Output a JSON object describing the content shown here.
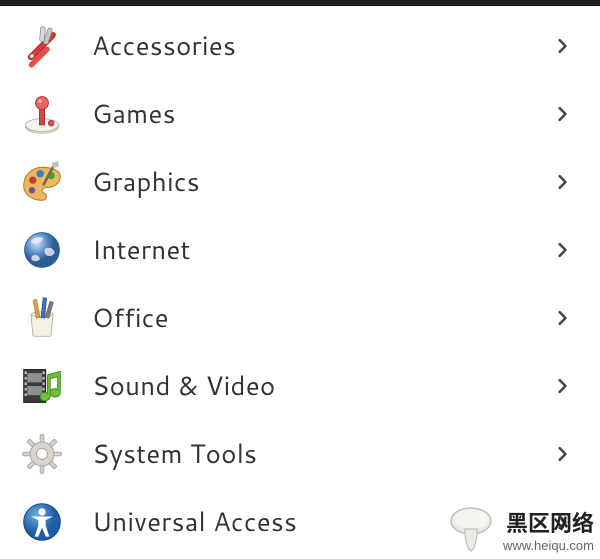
{
  "categories": [
    {
      "id": "accessories",
      "label": "Accessories",
      "icon": "swiss-army-knife-icon",
      "has_submenu": true
    },
    {
      "id": "games",
      "label": "Games",
      "icon": "joystick-icon",
      "has_submenu": true
    },
    {
      "id": "graphics",
      "label": "Graphics",
      "icon": "palette-icon",
      "has_submenu": true
    },
    {
      "id": "internet",
      "label": "Internet",
      "icon": "globe-icon",
      "has_submenu": true
    },
    {
      "id": "office",
      "label": "Office",
      "icon": "pen-holder-icon",
      "has_submenu": true
    },
    {
      "id": "sound-video",
      "label": "Sound & Video",
      "icon": "film-note-icon",
      "has_submenu": true
    },
    {
      "id": "system-tools",
      "label": "System Tools",
      "icon": "gear-icon",
      "has_submenu": true
    },
    {
      "id": "universal-access",
      "label": "Universal Access",
      "icon": "accessibility-icon",
      "has_submenu": true
    }
  ],
  "watermark": {
    "title_cn": "黑区网络",
    "url": "www.heiqu.com"
  }
}
